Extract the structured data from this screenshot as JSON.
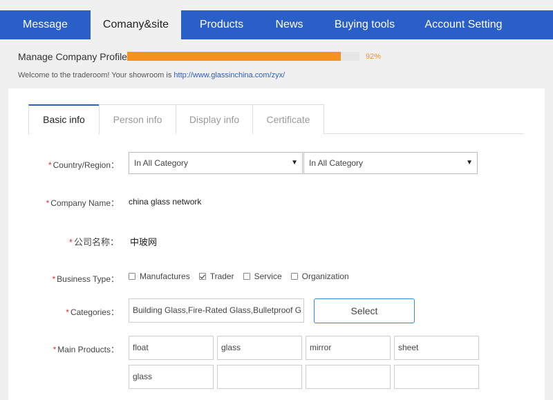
{
  "nav": {
    "items": [
      {
        "label": "Message"
      },
      {
        "label": "Comany&site"
      },
      {
        "label": "Products"
      },
      {
        "label": "News"
      },
      {
        "label": "Buying tools"
      },
      {
        "label": "Account Setting"
      }
    ],
    "active_index": 1
  },
  "profile": {
    "label": "Manage Company Profile",
    "progress_percent": 92,
    "progress_text": "92%",
    "welcome_text": "Welcome to the traderoom! Your showroom is ",
    "showroom_url": "http://www.glassinchina.com/zyx/"
  },
  "tabs": [
    {
      "label": "Basic info"
    },
    {
      "label": "Person info"
    },
    {
      "label": "Display info"
    },
    {
      "label": "Certificate"
    }
  ],
  "form": {
    "required_mark": "*",
    "country": {
      "label": "Country/Region：",
      "select1": "In All Category",
      "select2": "In All Category",
      "caret": "▼"
    },
    "company_name": {
      "label": "Company Name：",
      "value": "china glass network"
    },
    "company_name_cn": {
      "label": "公司名称：",
      "value": "中玻网"
    },
    "business_type": {
      "label": "Business Type：",
      "options": [
        {
          "label": "Manufactures",
          "checked": false
        },
        {
          "label": "Trader",
          "checked": true
        },
        {
          "label": "Service",
          "checked": false
        },
        {
          "label": "Organization",
          "checked": false
        }
      ]
    },
    "categories": {
      "label": "Categories：",
      "value": "Building Glass,Fire-Rated Glass,Bulletproof G",
      "button_label": "Select"
    },
    "main_products": {
      "label": "Main Products：",
      "values": [
        "float",
        "glass",
        "mirror",
        "sheet",
        "glass",
        "",
        "",
        ""
      ]
    }
  },
  "colors": {
    "nav_bg": "#2b5fc8",
    "progress": "#f7921e",
    "required": "#e02b2b",
    "link": "#2b5fc8"
  }
}
